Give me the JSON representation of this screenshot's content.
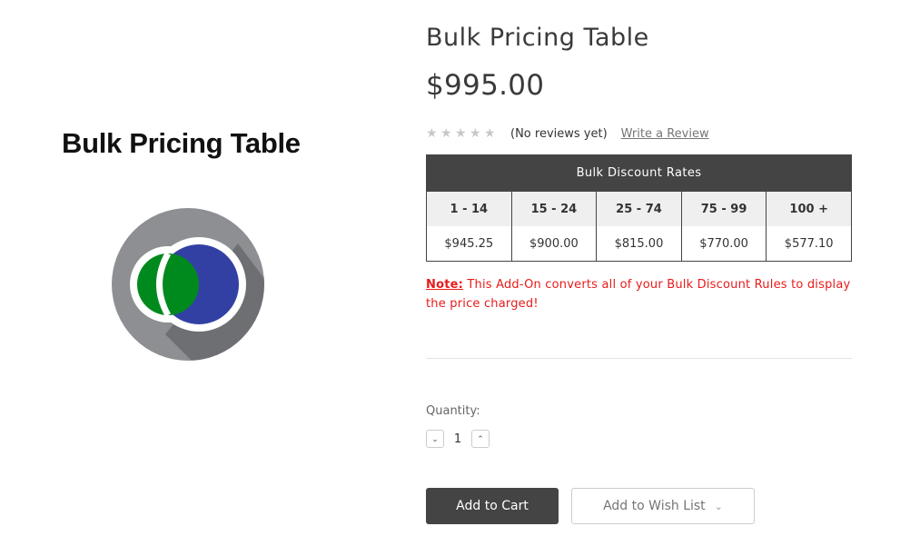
{
  "product": {
    "image_title": "Bulk Pricing Table",
    "title": "Bulk Pricing Table",
    "price": "$995.00",
    "rating_stars": 0,
    "reviews_text": "(No reviews yet)",
    "write_review_label": "Write a Review"
  },
  "bulk_table": {
    "header": "Bulk Discount Rates",
    "ranges": [
      "1 - 14",
      "15 - 24",
      "25 - 74",
      "75 - 99",
      "100 +"
    ],
    "prices": [
      "$945.25",
      "$900.00",
      "$815.00",
      "$770.00",
      "$577.10"
    ]
  },
  "note": {
    "label": "Note:",
    "text": " This Add-On converts all of your Bulk Discount Rules to display the price charged!"
  },
  "quantity": {
    "label": "Quantity:",
    "value": "1",
    "decrease_icon": "chevron-down-icon",
    "increase_icon": "chevron-up-icon"
  },
  "actions": {
    "add_to_cart": "Add to Cart",
    "add_to_wishlist": "Add to Wish List"
  },
  "colors": {
    "logo_green": "#008a1e",
    "logo_blue": "#3340a3",
    "logo_gray": "#8e8f93",
    "note_red": "#e81b1b",
    "dark": "#444444"
  }
}
